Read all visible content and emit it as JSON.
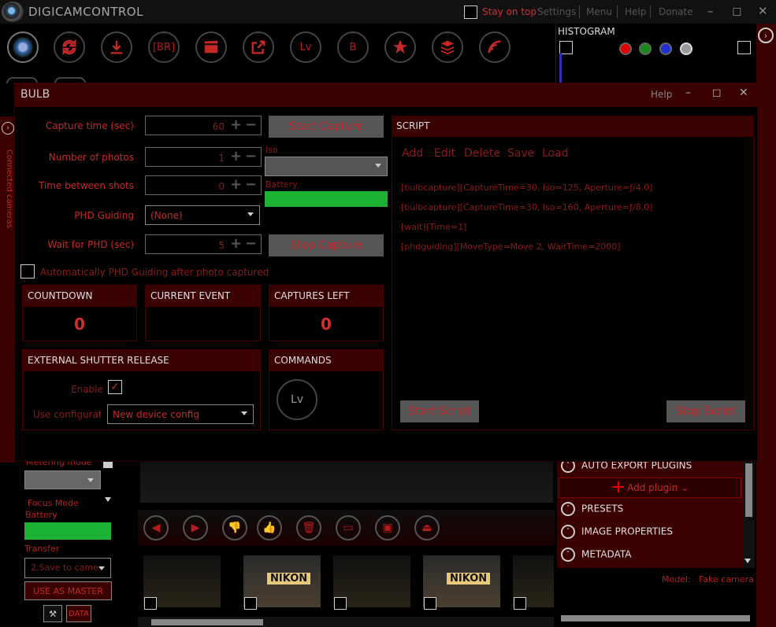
{
  "app": {
    "title": "DIGICAMCONTROL",
    "stay_on_top": "Stay on top",
    "links": [
      "Settings",
      "Menu",
      "Help",
      "Donate"
    ],
    "window_controls": [
      "–",
      "◻",
      "✕"
    ]
  },
  "toolbar": {
    "br_label": "[BR]",
    "lv_label": "Lv",
    "b_label": "B"
  },
  "histogram": {
    "title": "HISTOGRAM",
    "dot_colors": [
      "#e00000",
      "#1a8a1a",
      "#2030d0",
      "#9a9a9a"
    ]
  },
  "sidebar": {
    "connected_cameras": "Connected cameras"
  },
  "bulb": {
    "title": "BULB",
    "help": "Help",
    "controls": [
      "–",
      "◻",
      "✕"
    ],
    "capture_time_label": "Capture time (sec)",
    "capture_time_value": "60",
    "num_photos_label": "Number of photos",
    "num_photos_value": "1",
    "time_between_label": "Time between shots",
    "time_between_value": "0",
    "phd_guiding_label": "PHD Guiding",
    "phd_guiding_value": "(None)",
    "wait_phd_label": "Wait for PHD (sec)",
    "wait_phd_value": "5",
    "start_capture": "Start Capture",
    "stop_capture": "Stop Capture",
    "iso_label": "Iso",
    "battery_label": "Battery",
    "battery_color": "#1db233",
    "auto_phd_label": "Automatically PHD Guiding after photo captured",
    "countdown_title": "COUNTDOWN",
    "countdown_value": "0",
    "current_event_title": "CURRENT EVENT",
    "captures_left_title": "CAPTURES LEFT",
    "captures_left_value": "0",
    "external_title": "EXTERNAL SHUTTER RELEASE",
    "enable_label": "Enable",
    "use_config_label": "Use configuratio",
    "config_value": "New device config",
    "commands_title": "COMMANDS",
    "commands_lv": "Lv",
    "plus": "+",
    "minus": "−"
  },
  "script": {
    "title": "SCRIPT",
    "actions": [
      "Add",
      "Edit",
      "Delete",
      "Save",
      "Load"
    ],
    "lines": [
      "[bulbcapture][CaptureTime=30, Iso=125, Aperture=ƒ/4.0]",
      "[bulbcapture][CaptureTime=30, Iso=160, Aperture=ƒ/8.0]",
      "[wait][Time=1]",
      "[phdguiding][MoveType=Move 2, WaitTime=2000]"
    ],
    "start": "Start Script",
    "stop": "Stop Script"
  },
  "left_panel": {
    "metering_label": "Metering mode",
    "focus_label": "Focus Mode",
    "battery_label": "Battery",
    "transfer_label": "Transfer",
    "transfer_value": "2.Save to came",
    "master_button": "USE AS MASTER",
    "tool2_label": "DATA"
  },
  "right_panel": {
    "auto_export": "AUTO EXPORT PLUGINS",
    "add_plugin": "Add plugin",
    "presets": "PRESETS",
    "image_properties": "IMAGE PROPERTIES",
    "metadata": "METADATA",
    "model_label": "Model:",
    "model_value": "Fake camera"
  },
  "thumbs": {
    "text": "NIKON"
  }
}
